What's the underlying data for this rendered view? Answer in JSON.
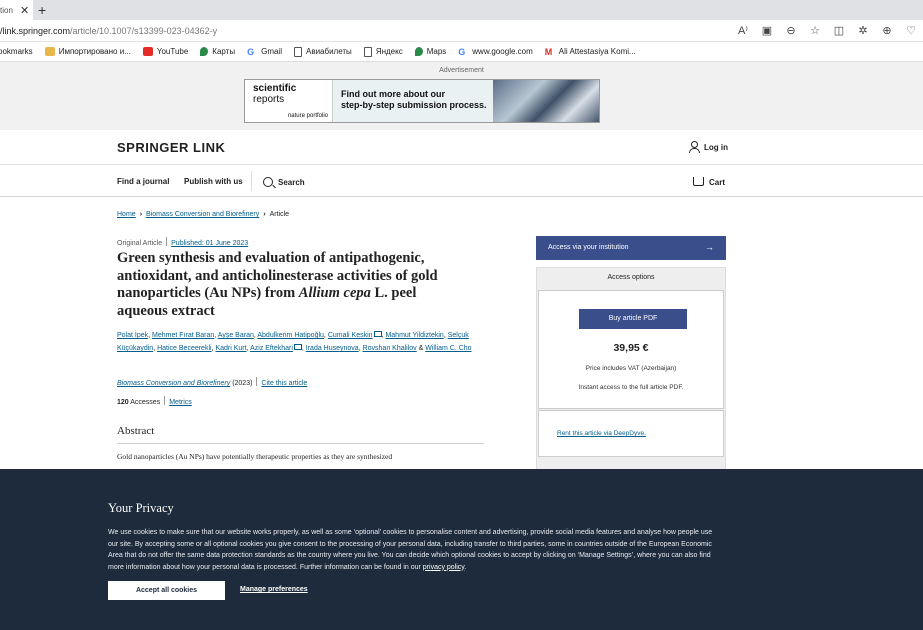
{
  "browser": {
    "tab_title": "tion",
    "url_host": "/link.springer.com",
    "url_path": "/article/10.1007/s13399-023-04362-y",
    "bookmarks": [
      {
        "label": "ookmarks",
        "icon": "none"
      },
      {
        "label": "Импортировано и...",
        "icon": "folder-icon"
      },
      {
        "label": "YouTube",
        "icon": "youtube-icon"
      },
      {
        "label": "Карты",
        "icon": "maps-icon"
      },
      {
        "label": "Gmail",
        "icon": "google-icon"
      },
      {
        "label": "Авиабилеты",
        "icon": "page-icon"
      },
      {
        "label": "Яндекс",
        "icon": "page-icon"
      },
      {
        "label": "Maps",
        "icon": "maps-icon"
      },
      {
        "label": "www.google.com",
        "icon": "google-icon"
      },
      {
        "label": "Ali Attestasiya Komi...",
        "icon": "gmail-icon"
      }
    ]
  },
  "ad": {
    "label": "Advertisement",
    "brand_line1": "scientific",
    "brand_line2": "reports",
    "publisher": "nature portfolio",
    "headline_line1": "Find out more about our",
    "headline_line2": "step-by-step submission process."
  },
  "header": {
    "logo": "SPRINGER LINK",
    "login": "Log in",
    "nav": {
      "find_journal": "Find a journal",
      "publish": "Publish with us",
      "search": "Search",
      "cart": "Cart"
    }
  },
  "breadcrumb": {
    "home": "Home",
    "journal": "Biomass Conversion and Biorefinery",
    "current": "Article"
  },
  "article": {
    "type": "Original Article",
    "published": "Published: 01 June 2023",
    "title_line1": "Green synthesis and evaluation of antipathogenic,",
    "title_line2": "antioxidant, and anticholinesterase activities of gold",
    "title_line3_pre": "nanoparticles (Au NPs) from ",
    "title_italic": "Allium cepa",
    "title_line3_post": " L. peel",
    "title_line4": "aqueous extract",
    "authors": [
      "Polat İpek",
      "Mehmet Fırat Baran",
      "Ayşe Baran",
      "Abdulkerim Hatipoğlu",
      "Cumali Keskin",
      "Mahmut Yildiztekin",
      "Selçuk Küçükaydin",
      "Hatice Beceerekli",
      "Kadri Kurt",
      "Aziz Eftekhari",
      "Irada Huseynova",
      "Rovshan Khalilov",
      "William C. Cho"
    ],
    "journal": "Biomass Conversion and Biorefinery",
    "year": "(2023)",
    "cite": "Cite this article",
    "accesses_count": "120",
    "accesses_label": "Accesses",
    "metrics": "Metrics",
    "abstract_heading": "Abstract",
    "abstract_line1": "Gold nanoparticles (Au NPs) have potentially therapeutic properties as they are synthesized"
  },
  "sidebar": {
    "access_institution": "Access via your institution",
    "access_options": "Access options",
    "buy_pdf": "Buy article PDF",
    "price": "39,95 €",
    "vat": "Price includes VAT (Azerbaijan)",
    "instant": "Instant access to the full article PDF.",
    "rent": "Rent this article via DeepDyve."
  },
  "privacy": {
    "heading": "Your Privacy",
    "body": "We use cookies to make sure that our website works properly, as well as some ‘optional’ cookies to personalise content and advertising, provide social media features and analyse how people use our site. By accepting some or all optional cookies you give consent to the processing of your personal data, including transfer to third parties, some in countries outside of the European Economic Area that do not offer the same data protection standards as the country where you live. You can decide which optional cookies to accept by clicking on ‘Manage Settings’, where you can also find more information about how your personal data is processed. Further information can be found in our ",
    "policy_link": "privacy policy",
    "accept": "Accept all cookies",
    "manage": "Manage preferences"
  }
}
